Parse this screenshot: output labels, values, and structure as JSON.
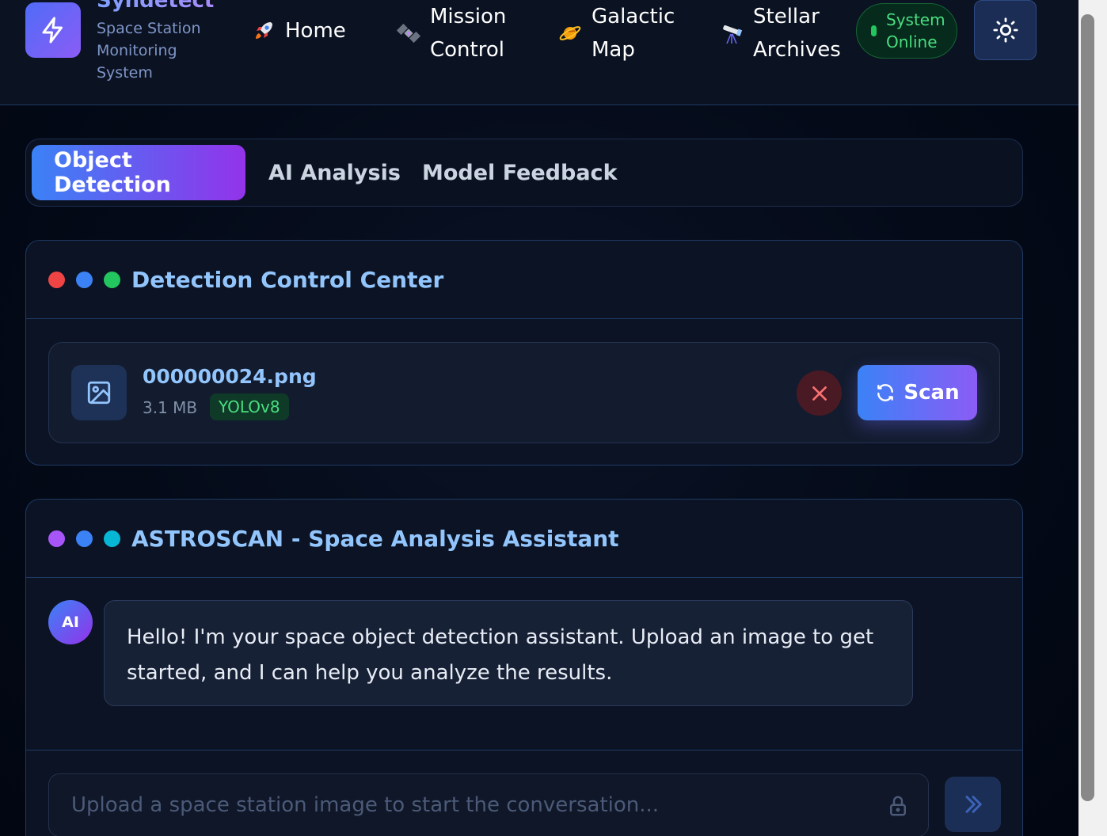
{
  "brand": {
    "name": "Syndetect",
    "subtitle": "Space Station Monitoring System",
    "logo_icon": "lightning-icon"
  },
  "nav": [
    {
      "label": "Home",
      "icon": "rocket-icon"
    },
    {
      "label": "Mission Control",
      "icon": "satellite-icon"
    },
    {
      "label": "Galactic Map",
      "icon": "planet-icon"
    },
    {
      "label": "Stellar Archives",
      "icon": "telescope-icon"
    }
  ],
  "status": {
    "label": "System Online",
    "color": "#22c55e"
  },
  "theme_toggle": {
    "icon": "sun-icon"
  },
  "tabs": [
    {
      "label": "Object Detection",
      "active": true
    },
    {
      "label": "AI Analysis",
      "active": false
    },
    {
      "label": "Model Feedback",
      "active": false
    }
  ],
  "detection_panel": {
    "title": "Detection Control Center",
    "dots": [
      "#ef4444",
      "#3b82f6",
      "#22c55e"
    ],
    "file": {
      "name": "000000024.png",
      "size": "3.1 MB",
      "model": "YOLOv8",
      "icon": "image-icon"
    },
    "scan_label": "Scan",
    "remove_icon": "close-icon"
  },
  "chat_panel": {
    "title": "ASTROSCAN - Space Analysis Assistant",
    "dots": [
      "#a855f7",
      "#3b82f6",
      "#06b6d4"
    ],
    "avatar": "AI",
    "message": "Hello! I'm your space object detection assistant. Upload an image to get started, and I can help you analyze the results.",
    "input_placeholder": "Upload a space station image to start the conversation...",
    "send_icon": "double-chevron-right-icon"
  },
  "colors": {
    "accent_start": "#3b82f6",
    "accent_end": "#9333ea",
    "background": "#040a18"
  }
}
